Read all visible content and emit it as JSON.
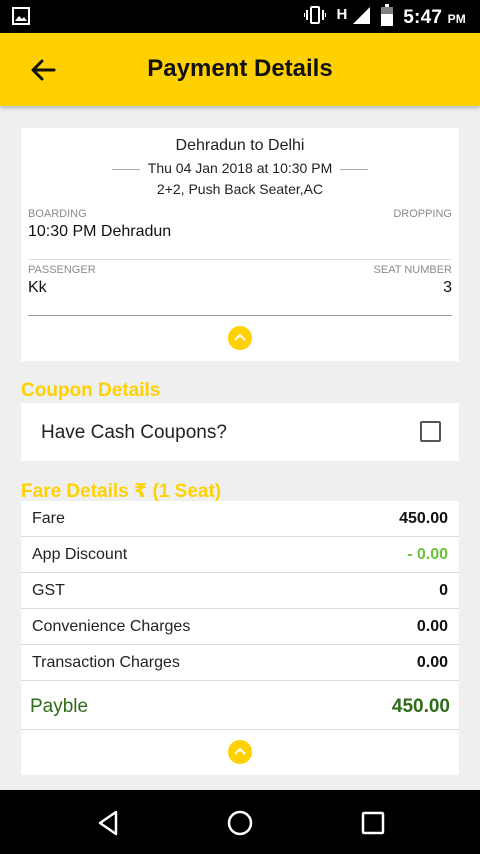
{
  "status_bar": {
    "network_type": "H",
    "time": "5:47",
    "time_suffix": "PM"
  },
  "header": {
    "title": "Payment Details",
    "back_icon": "arrow-left-icon"
  },
  "journey": {
    "route": "Dehradun to Delhi",
    "datetime": "Thu 04 Jan 2018 at 10:30 PM",
    "bus_type": "2+2, Push Back Seater,AC",
    "boarding_label": "BOARDING",
    "boarding_value": "10:30 PM Dehradun",
    "dropping_label": "DROPPING",
    "dropping_value": "",
    "passenger_label": "PASSENGER",
    "passenger_value": "Kk",
    "seat_label": "SEAT NUMBER",
    "seat_value": "3"
  },
  "coupon": {
    "section_title": "Coupon Details",
    "label": "Have Cash Coupons?",
    "checked": false
  },
  "fare": {
    "section_title": "Fare Details ₹ (1 Seat)",
    "rows": [
      {
        "name": "Fare",
        "amount": "450.00"
      },
      {
        "name": "App Discount",
        "amount": "- 0.00"
      },
      {
        "name": "GST",
        "amount": "0"
      },
      {
        "name": "Convenience Charges",
        "amount": "0.00"
      },
      {
        "name": "Transaction Charges",
        "amount": "0.00"
      }
    ],
    "payable_label": "Payble",
    "payable_amount": "450.00"
  },
  "colors": {
    "accent": "#ffd100",
    "discount_green": "#6cc23a",
    "payable_green": "#2e6b1a"
  },
  "nav_bar": {
    "icons": [
      "nav-back-icon",
      "nav-home-icon",
      "nav-recents-icon"
    ]
  }
}
